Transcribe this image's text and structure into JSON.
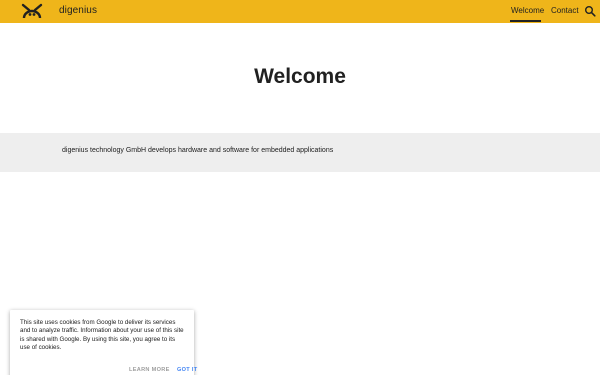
{
  "header": {
    "site_name": "digenius",
    "logo_icon": "digenius-logo-icon",
    "background_color": "#efb51a",
    "nav": [
      {
        "label": "Welcome",
        "active": true
      },
      {
        "label": "Contact",
        "active": false
      }
    ],
    "search_icon": "search-icon"
  },
  "hero": {
    "title": "Welcome"
  },
  "band": {
    "text": "digenius technology GmbH develops hardware and software for embedded applications",
    "background_color": "#eeeeee"
  },
  "cookie_notice": {
    "text": "This site uses cookies from Google to deliver its services and to analyze traffic. Information about your use of this site is shared with Google. By using this site, you agree to its use of cookies.",
    "learn_more": "LEARN MORE",
    "got_it": "GOT IT",
    "accent_color": "#4285f4"
  }
}
